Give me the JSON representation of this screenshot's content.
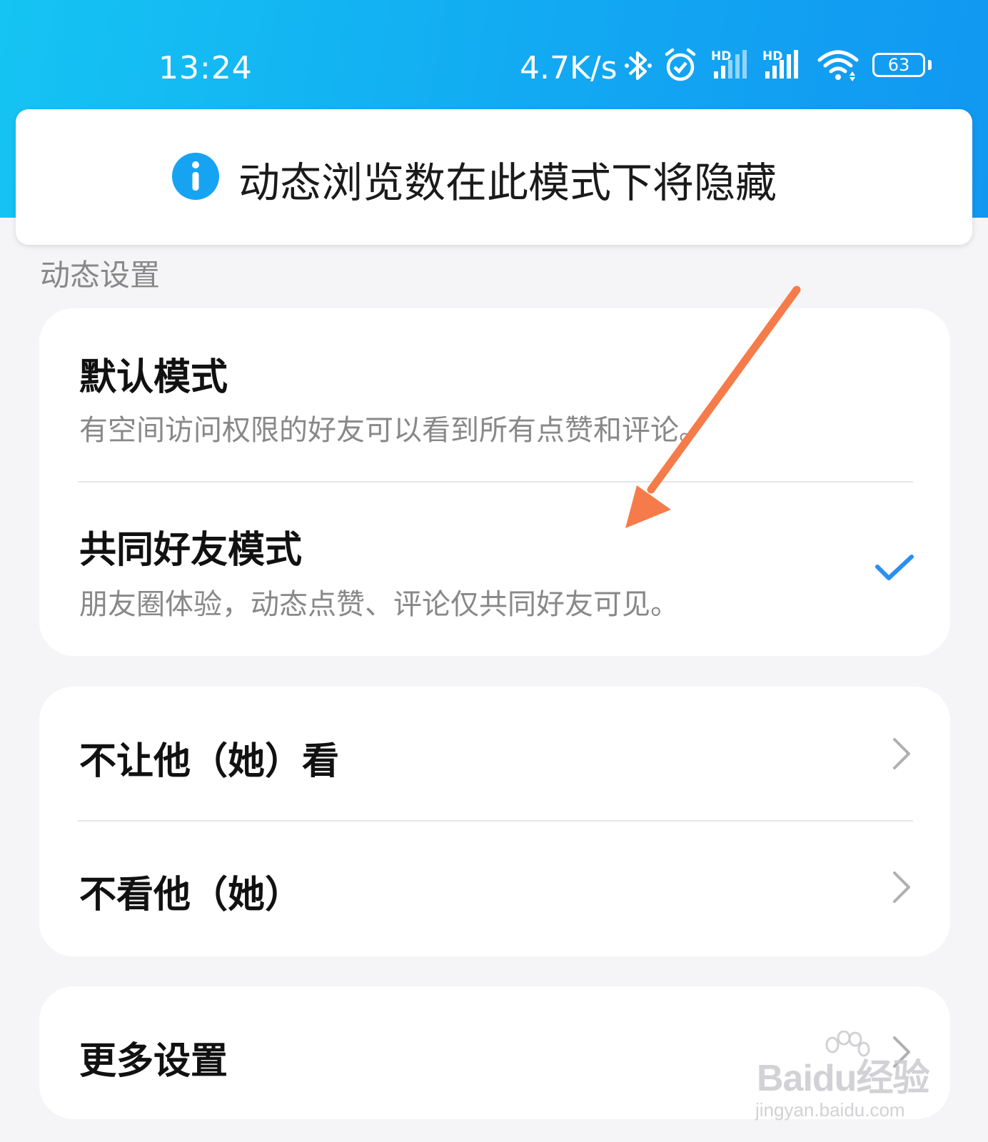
{
  "status_bar": {
    "time": "13:24",
    "network_speed": "4.7K/s",
    "battery_level": "63",
    "icons": [
      "bluetooth-icon",
      "alarm-icon",
      "hd-signal-icon",
      "hd-signal-icon",
      "wifi-icon",
      "battery-icon"
    ]
  },
  "toast": {
    "icon": "info-icon",
    "message": "动态浏览数在此模式下将隐藏"
  },
  "section": {
    "title": "动态设置"
  },
  "modes": [
    {
      "title": "默认模式",
      "description": "有空间访问权限的好友可以看到所有点赞和评论。",
      "selected": false
    },
    {
      "title": "共同好友模式",
      "description": "朋友圈体验，动态点赞、评论仅共同好友可见。",
      "selected": true
    }
  ],
  "privacy": [
    {
      "label": "不让他（她）看"
    },
    {
      "label": "不看他（她）"
    }
  ],
  "more": {
    "label": "更多设置"
  },
  "watermark": {
    "logo_text": "Baidu经验",
    "url": "jingyan.baidu.com"
  },
  "colors": {
    "header": "#12a9f2",
    "accent": "#2a8ff0",
    "annotation_arrow": "#f57c4a"
  }
}
